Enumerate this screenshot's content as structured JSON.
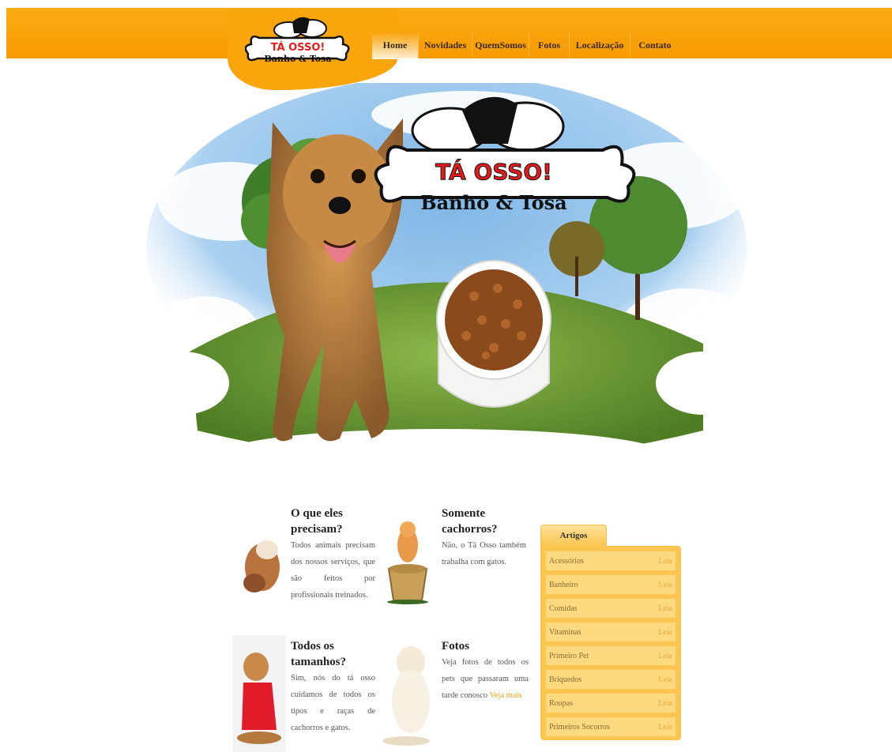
{
  "brand": {
    "name": "TÁ OSSO!",
    "tagline": "Banho & Tosa"
  },
  "nav": [
    {
      "label": "Home",
      "active": true
    },
    {
      "label": "Novidades",
      "active": false
    },
    {
      "label": "QuemSomos",
      "active": false
    },
    {
      "label": "Fotos",
      "active": false
    },
    {
      "label": "Localização",
      "active": false
    },
    {
      "label": "Contato",
      "active": false
    }
  ],
  "blocks": {
    "precisam": {
      "title": "O que eles precisam?",
      "text": "Todos animais precisam dos nossos serviços, que são feitos por profissionais treinados."
    },
    "cachorros": {
      "title": "Somente cachorros?",
      "text": "Não, o Tá Osso também trabalha com gatos."
    },
    "tamanhos": {
      "title": "Todos os tamanhos?",
      "text": "Sim, nós do tá osso cuidamos de todos os tipos e raças de cachorros e gatos."
    },
    "fotos": {
      "title": "Fotos",
      "text": "Veja fotos de todos os pets que passaram uma tarde conosco",
      "link": "Veja mais"
    }
  },
  "sidebar": {
    "tab": "Artigos",
    "items": [
      {
        "label": "Acessórios",
        "action": "Leia"
      },
      {
        "label": "Banheiro",
        "action": "Leia"
      },
      {
        "label": "Comidas",
        "action": "Leia"
      },
      {
        "label": "Vitaminas",
        "action": "Leia"
      },
      {
        "label": "Primeiro Pet",
        "action": "Leia"
      },
      {
        "label": "Briquedos",
        "action": "Leia"
      },
      {
        "label": "Roupas",
        "action": "Leia"
      },
      {
        "label": "Primeiros Socorros",
        "action": "Leia"
      }
    ]
  },
  "colors": {
    "orange": "#f9a50b",
    "panel": "#fcc54e",
    "link": "#f39c12"
  }
}
